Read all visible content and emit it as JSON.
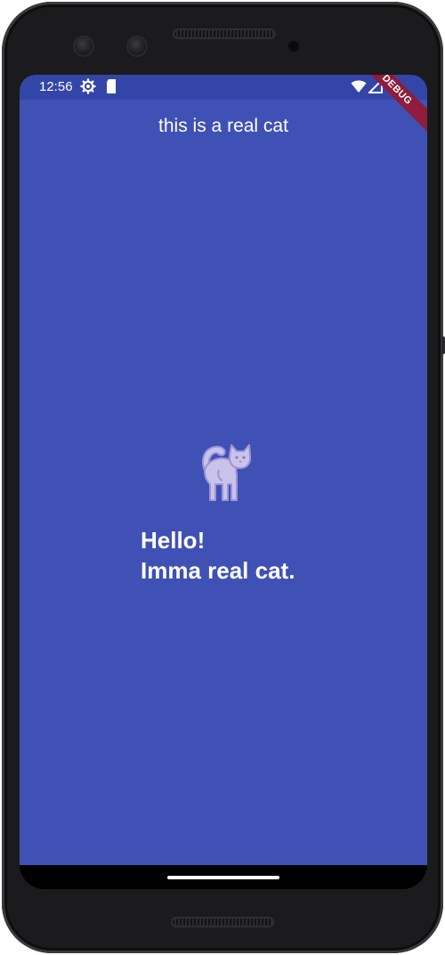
{
  "status_bar": {
    "time": "12:56",
    "icons": [
      "settings-icon",
      "sd-card-icon",
      "wifi-icon",
      "signal-icon",
      "battery-icon"
    ]
  },
  "app": {
    "title": "this is a real cat",
    "greeting_line1": "Hello!",
    "greeting_line2": "Imma real cat.",
    "debug_banner": "DEBUG",
    "background_color": "#3f51b5",
    "statusbar_color": "#3346a8"
  }
}
